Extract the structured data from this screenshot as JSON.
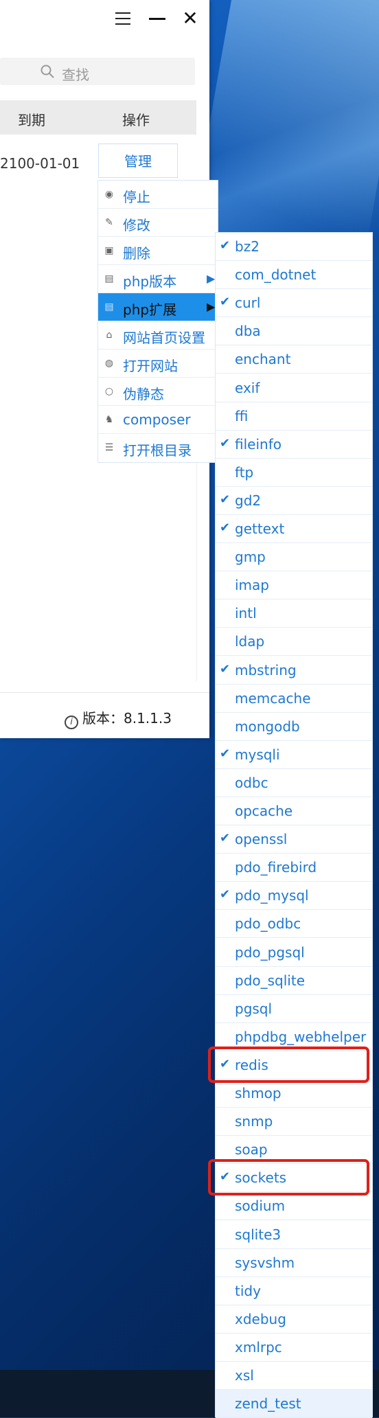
{
  "window": {
    "search_placeholder": "查找",
    "columns": [
      "到期",
      "操作"
    ],
    "row": {
      "expiry": "2100-01-01",
      "action_label": "管理"
    },
    "version_label": "版本：8.1.1.3"
  },
  "context_menu": {
    "items": [
      {
        "label": "停止",
        "icon": "stop-icon"
      },
      {
        "label": "修改",
        "icon": "pencil-icon"
      },
      {
        "label": "删除",
        "icon": "trash-icon"
      },
      {
        "label": "php版本",
        "icon": "php-version-icon",
        "submenu": true
      },
      {
        "label": "php扩展",
        "icon": "php-extension-icon",
        "submenu": true,
        "active": true
      },
      {
        "label": "网站首页设置",
        "icon": "home-icon"
      },
      {
        "label": "打开网站",
        "icon": "globe-icon"
      },
      {
        "label": "伪静态",
        "icon": "circle-icon"
      },
      {
        "label": "composer",
        "icon": "composer-icon"
      },
      {
        "label": "打开根目录",
        "icon": "list-icon"
      }
    ]
  },
  "extensions": [
    {
      "name": "bz2",
      "checked": true
    },
    {
      "name": "com_dotnet",
      "checked": false
    },
    {
      "name": "curl",
      "checked": true
    },
    {
      "name": "dba",
      "checked": false
    },
    {
      "name": "enchant",
      "checked": false
    },
    {
      "name": "exif",
      "checked": false
    },
    {
      "name": "ffi",
      "checked": false
    },
    {
      "name": "fileinfo",
      "checked": true
    },
    {
      "name": "ftp",
      "checked": false
    },
    {
      "name": "gd2",
      "checked": true
    },
    {
      "name": "gettext",
      "checked": true
    },
    {
      "name": "gmp",
      "checked": false
    },
    {
      "name": "imap",
      "checked": false
    },
    {
      "name": "intl",
      "checked": false
    },
    {
      "name": "ldap",
      "checked": false
    },
    {
      "name": "mbstring",
      "checked": true
    },
    {
      "name": "memcache",
      "checked": false
    },
    {
      "name": "mongodb",
      "checked": false
    },
    {
      "name": "mysqli",
      "checked": true
    },
    {
      "name": "odbc",
      "checked": false
    },
    {
      "name": "opcache",
      "checked": false
    },
    {
      "name": "openssl",
      "checked": true
    },
    {
      "name": "pdo_firebird",
      "checked": false
    },
    {
      "name": "pdo_mysql",
      "checked": true
    },
    {
      "name": "pdo_odbc",
      "checked": false
    },
    {
      "name": "pdo_pgsql",
      "checked": false
    },
    {
      "name": "pdo_sqlite",
      "checked": false
    },
    {
      "name": "pgsql",
      "checked": false
    },
    {
      "name": "phpdbg_webhelper",
      "checked": false
    },
    {
      "name": "redis",
      "checked": true,
      "highlighted": true
    },
    {
      "name": "shmop",
      "checked": false
    },
    {
      "name": "snmp",
      "checked": false
    },
    {
      "name": "soap",
      "checked": false
    },
    {
      "name": "sockets",
      "checked": true,
      "highlighted": true
    },
    {
      "name": "sodium",
      "checked": false
    },
    {
      "name": "sqlite3",
      "checked": false
    },
    {
      "name": "sysvshm",
      "checked": false
    },
    {
      "name": "tidy",
      "checked": false
    },
    {
      "name": "xdebug",
      "checked": false
    },
    {
      "name": "xmlrpc",
      "checked": false
    },
    {
      "name": "xsl",
      "checked": false
    },
    {
      "name": "zend_test",
      "checked": false
    }
  ],
  "colors": {
    "accent": "#1e78d2",
    "menu_active": "#1e8fe8",
    "highlight": "#e0201a"
  }
}
